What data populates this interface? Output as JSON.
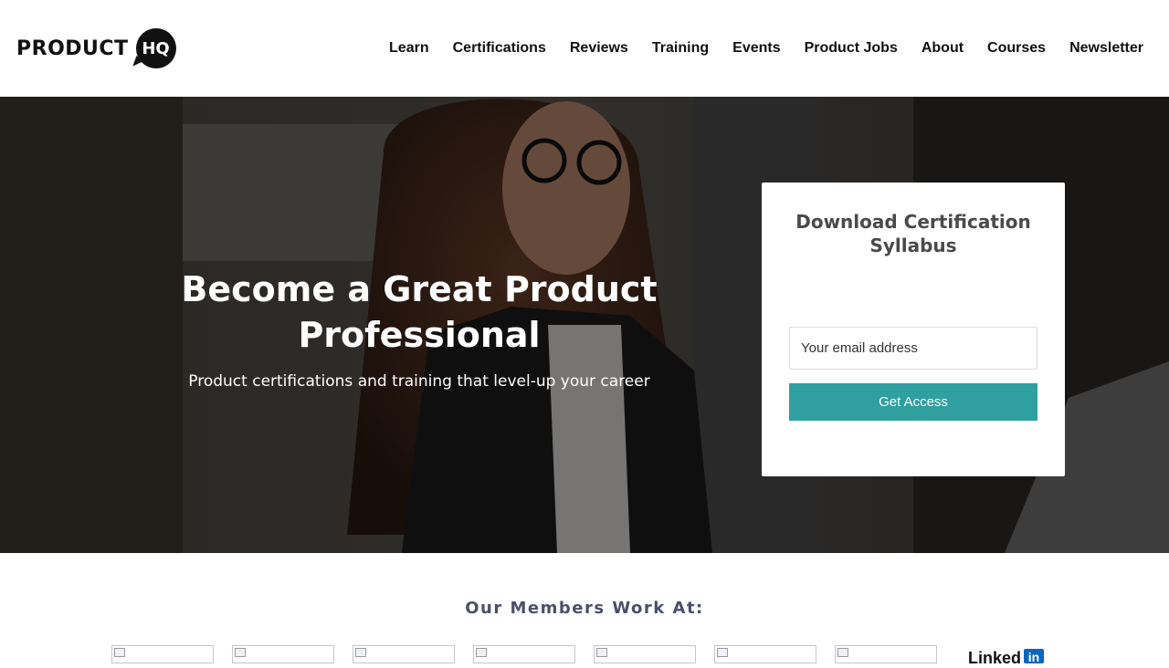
{
  "header": {
    "logo_text": "PRODUCT",
    "logo_badge": "HQ",
    "nav": [
      {
        "label": "Learn"
      },
      {
        "label": "Certifications"
      },
      {
        "label": "Reviews"
      },
      {
        "label": "Training"
      },
      {
        "label": "Events"
      },
      {
        "label": "Product Jobs"
      },
      {
        "label": "About"
      },
      {
        "label": "Courses"
      },
      {
        "label": "Newsletter"
      }
    ]
  },
  "hero": {
    "title": "Become a Great Product Professional",
    "subtitle": "Product certifications and training that level-up your career",
    "background_image": "photo-woman-with-glasses-at-laptop"
  },
  "signup_card": {
    "title": "Download Certification Syllabus",
    "email_placeholder": "Your email address",
    "button_label": "Get Access"
  },
  "members": {
    "title": "Our Members Work At:",
    "logo_count_visible": 7,
    "last_logo_text": "Linked",
    "last_logo_badge": "in"
  },
  "colors": {
    "accent_button": "#2f9fa0",
    "members_title": "#4b5068",
    "linkedin_blue": "#0a66c2"
  }
}
